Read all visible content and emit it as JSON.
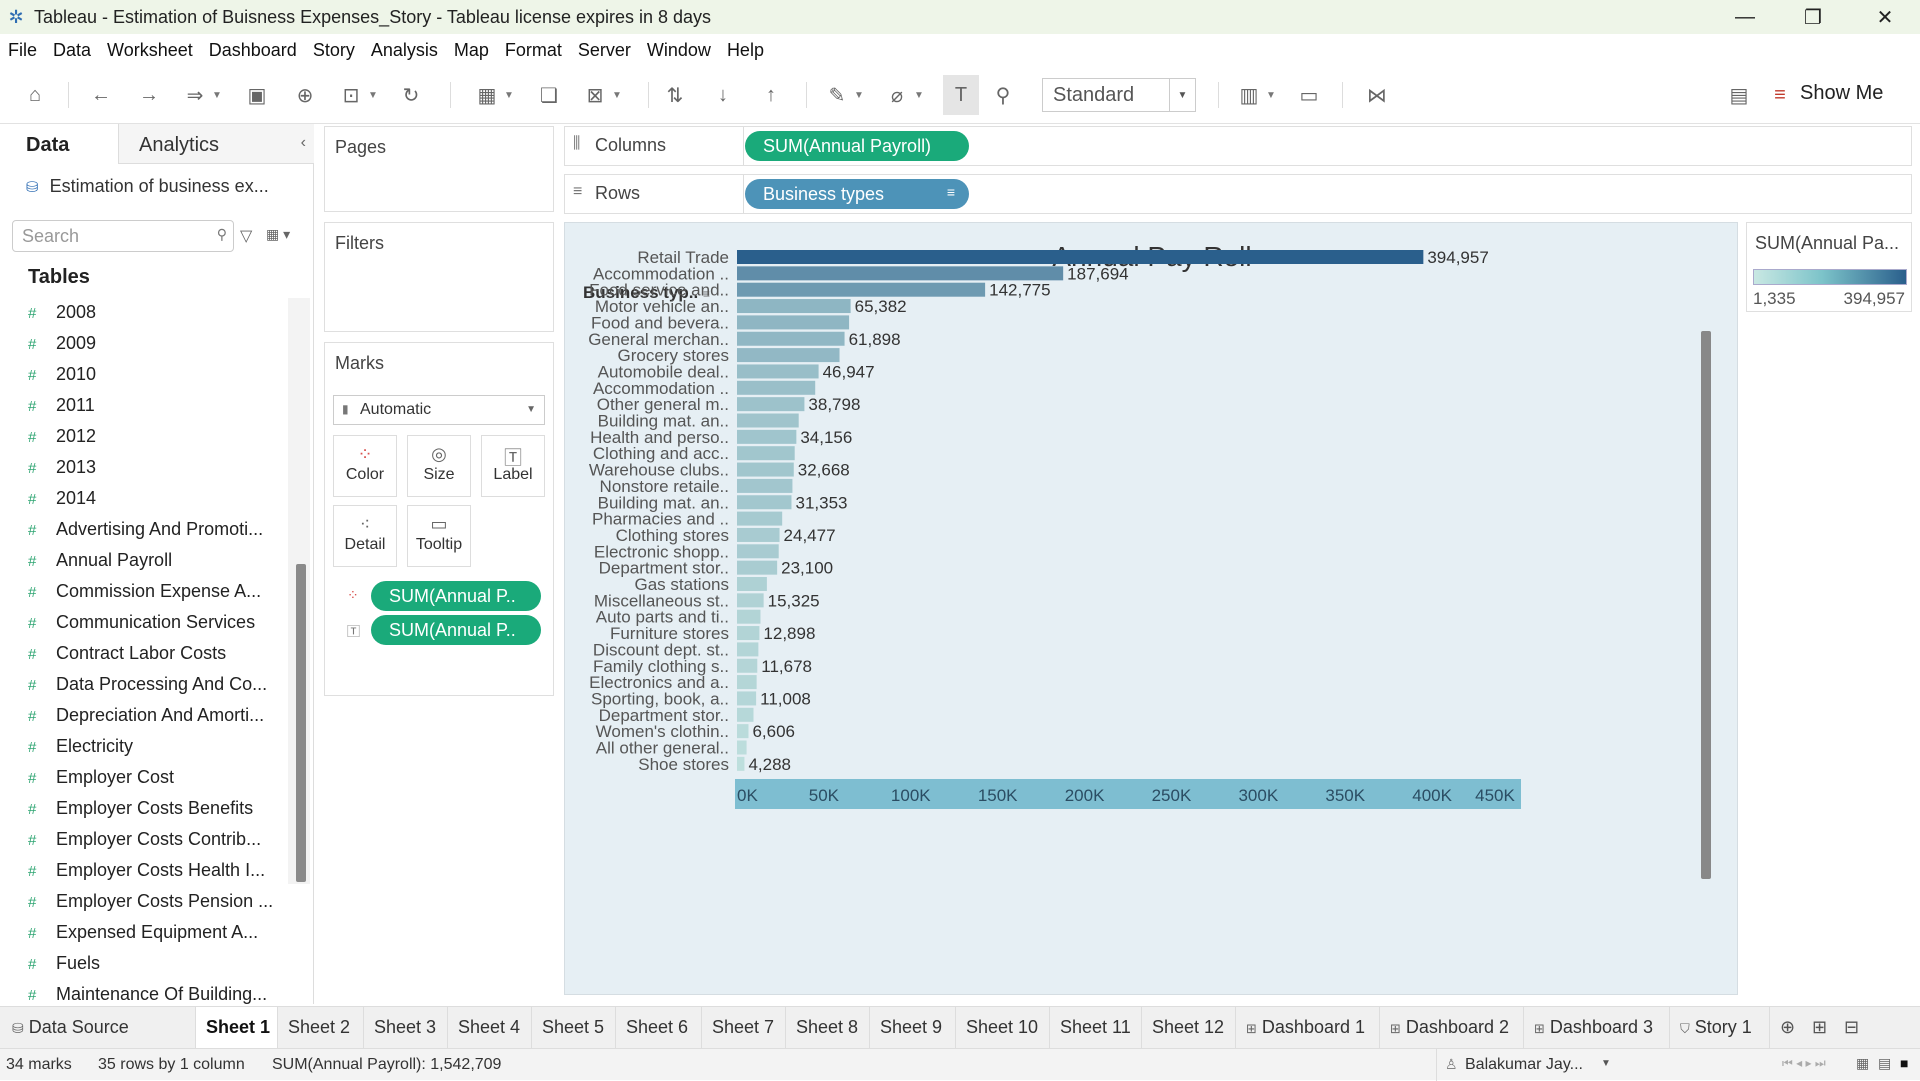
{
  "window": {
    "title": "Tableau - Estimation of Buisness Expenses_Story - Tableau license expires in 8 days",
    "minimize": "—",
    "restore": "❐",
    "close": "✕"
  },
  "menu": [
    "File",
    "Data",
    "Worksheet",
    "Dashboard",
    "Story",
    "Analysis",
    "Map",
    "Format",
    "Server",
    "Window",
    "Help"
  ],
  "toolbar": {
    "view_mode": "Standard",
    "show_me": "Show Me"
  },
  "left_pane": {
    "tab_data": "Data",
    "tab_analytics": "Analytics",
    "datasource": "Estimation of business ex...",
    "search_placeholder": "Search",
    "tables_label": "Tables",
    "fields": [
      "2008",
      "2009",
      "2010",
      "2011",
      "2012",
      "2013",
      "2014",
      "Advertising And Promoti...",
      "Annual Payroll",
      "Commission Expense A...",
      "Communication Services",
      "Contract Labor Costs",
      "Data Processing And Co...",
      "Depreciation And Amorti...",
      "Electricity",
      "Employer Cost",
      "Employer Costs Benefits",
      "Employer Costs Contrib...",
      "Employer Costs Health I...",
      "Employer Costs Pension ...",
      "Expensed Equipment A...",
      "Fuels",
      "Maintenance Of Building..."
    ]
  },
  "shelves": {
    "pages": "Pages",
    "filters": "Filters",
    "marks": "Marks",
    "mark_type": "Automatic",
    "mark_buttons": [
      "Color",
      "Size",
      "Label",
      "Detail",
      "Tooltip"
    ],
    "mark_pills": [
      "SUM(Annual P..",
      "SUM(Annual P.."
    ],
    "columns_label": "Columns",
    "rows_label": "Rows",
    "columns_pill": "SUM(Annual Payroll)",
    "rows_pill": "Business types"
  },
  "legend": {
    "title": "SUM(Annual Pa...",
    "min": "1,335",
    "max": "394,957",
    "color_low": "#c9e8e3",
    "color_high": "#2a5f8c"
  },
  "chart_data": {
    "type": "bar",
    "title": "Annual Pay Roll",
    "row_header": "Business typ..",
    "orientation": "horizontal",
    "xlim": [
      0,
      450000
    ],
    "x_ticks": [
      "0K",
      "50K",
      "100K",
      "150K",
      "200K",
      "250K",
      "300K",
      "350K",
      "400K",
      "450K"
    ],
    "categories": [
      "Retail Trade",
      "Accommodation ..",
      "Food service and..",
      "Motor vehicle an..",
      "Food and bevera..",
      "General merchan..",
      "Grocery stores",
      "Automobile deal..",
      "Accommodation ..",
      "Other general m..",
      "Building mat. an..",
      "Health and perso..",
      "Clothing and acc..",
      "Warehouse clubs..",
      "Nonstore retaile..",
      "Building mat. an..",
      "Pharmacies and ..",
      "Clothing stores",
      "Electronic shopp..",
      "Department stor..",
      "Gas stations",
      "Miscellaneous st..",
      "Auto parts and ti..",
      "Furniture stores",
      "Discount dept. st..",
      "Family clothing s..",
      "Electronics and a..",
      "Sporting, book, a..",
      "Department stor..",
      "Women's clothin..",
      "All other general..",
      "Shoe stores"
    ],
    "values": [
      394957,
      187694,
      142775,
      65382,
      64500,
      61898,
      59000,
      46947,
      45000,
      38798,
      35500,
      34156,
      33200,
      32668,
      31900,
      31353,
      26000,
      24477,
      24000,
      23100,
      17200,
      15325,
      13500,
      12898,
      12300,
      11678,
      11300,
      11008,
      9500,
      6606,
      5500,
      4288
    ],
    "labels": [
      "394,957",
      "187,694",
      "142,775",
      "65,382",
      "",
      "61,898",
      "",
      "46,947",
      "",
      "38,798",
      "",
      "34,156",
      "",
      "32,668",
      "",
      "31,353",
      "",
      "24,477",
      "",
      "23,100",
      "",
      "15,325",
      "",
      "12,898",
      "",
      "11,678",
      "",
      "11,008",
      "",
      "6,606",
      "",
      "4,288"
    ],
    "color_scale": [
      "#c9e8e3",
      "#2a5f8c"
    ],
    "max_value": 394957,
    "min_value": 1335
  },
  "sheet_tabs": [
    "Data Source",
    "Sheet 1",
    "Sheet 2",
    "Sheet 3",
    "Sheet 4",
    "Sheet 5",
    "Sheet 6",
    "Sheet 7",
    "Sheet 8",
    "Sheet 9",
    "Sheet 10",
    "Sheet 11",
    "Sheet 12",
    "Dashboard 1",
    "Dashboard 2",
    "Dashboard 3",
    "Story 1"
  ],
  "status": {
    "marks": "34 marks",
    "rows": "35 rows by 1 column",
    "sum": "SUM(Annual Payroll): 1,542,709",
    "user": "Balakumar Jay..."
  }
}
